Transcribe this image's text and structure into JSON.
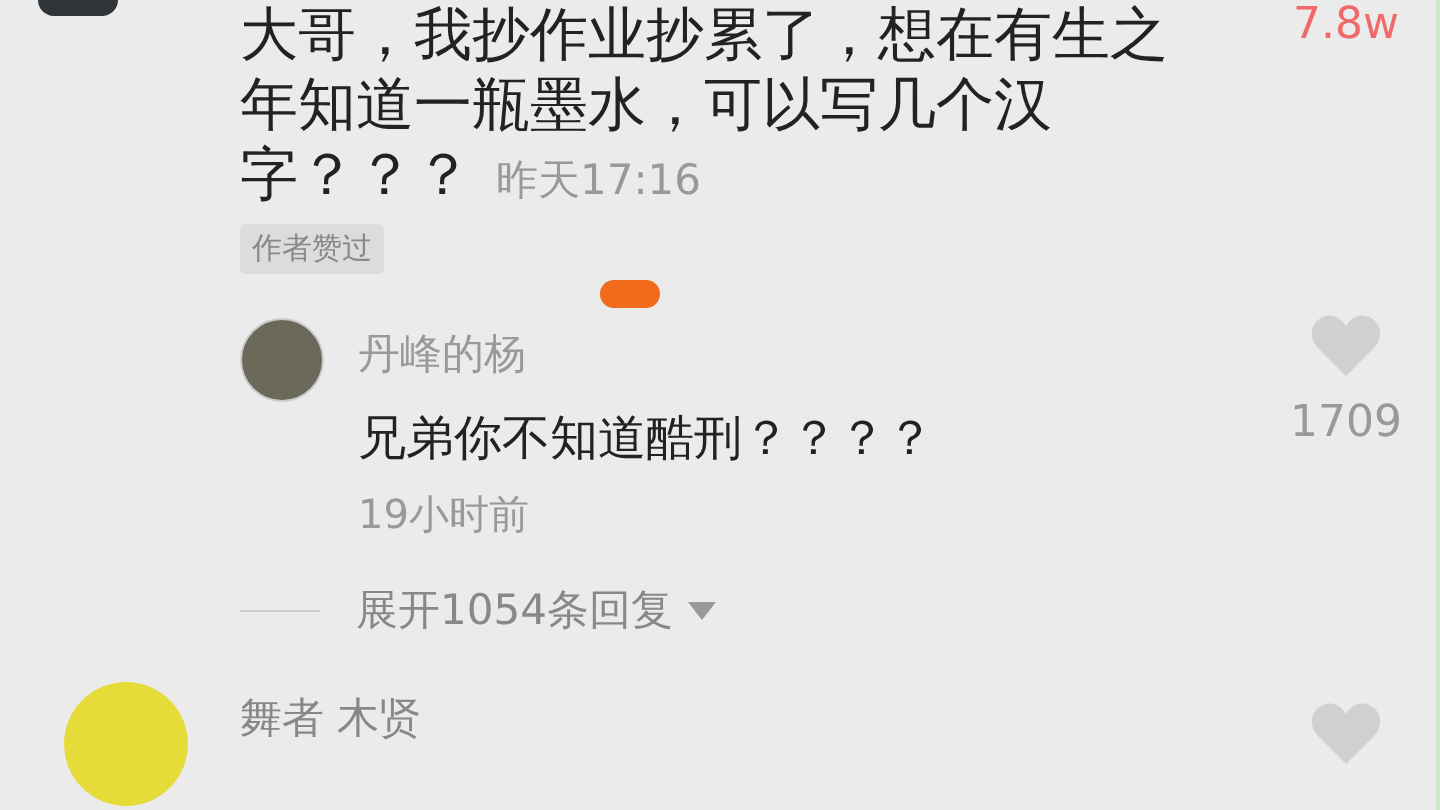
{
  "comment": {
    "text": "大哥，我抄作业抄累了，想在有生之年知道一瓶墨水，可以写几个汉字？？？",
    "time": "昨天17:16",
    "badge": "作者赞过",
    "likes": "7.8w",
    "liked": true
  },
  "reply": {
    "author": "丹峰的杨",
    "text": "兄弟你不知道酷刑？？？？",
    "time": "19小时前",
    "likes": "1709",
    "liked": false
  },
  "expand": {
    "label": "展开1054条回复"
  },
  "next_comment": {
    "author": "舞者 木贤",
    "liked": false
  }
}
